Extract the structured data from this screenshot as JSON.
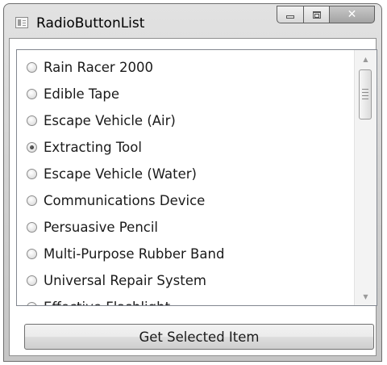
{
  "window": {
    "title": "RadioButtonList",
    "controls": {
      "minimize": "minimize",
      "maximize": "maximize",
      "close": "close"
    }
  },
  "list": {
    "selected_index": 3,
    "items": [
      {
        "label": "Rain Racer 2000",
        "checked": false
      },
      {
        "label": "Edible Tape",
        "checked": false
      },
      {
        "label": "Escape Vehicle (Air)",
        "checked": false
      },
      {
        "label": "Extracting Tool",
        "checked": true
      },
      {
        "label": "Escape Vehicle (Water)",
        "checked": false
      },
      {
        "label": "Communications Device",
        "checked": false
      },
      {
        "label": "Persuasive Pencil",
        "checked": false
      },
      {
        "label": "Multi-Purpose Rubber Band",
        "checked": false
      },
      {
        "label": "Universal Repair System",
        "checked": false
      },
      {
        "label": "Effective Flashlight",
        "checked": false
      }
    ]
  },
  "action": {
    "label": "Get Selected Item"
  },
  "icons": {
    "up": "scroll-up-arrow-icon",
    "down": "scroll-down-arrow-icon",
    "close": "close-icon"
  }
}
